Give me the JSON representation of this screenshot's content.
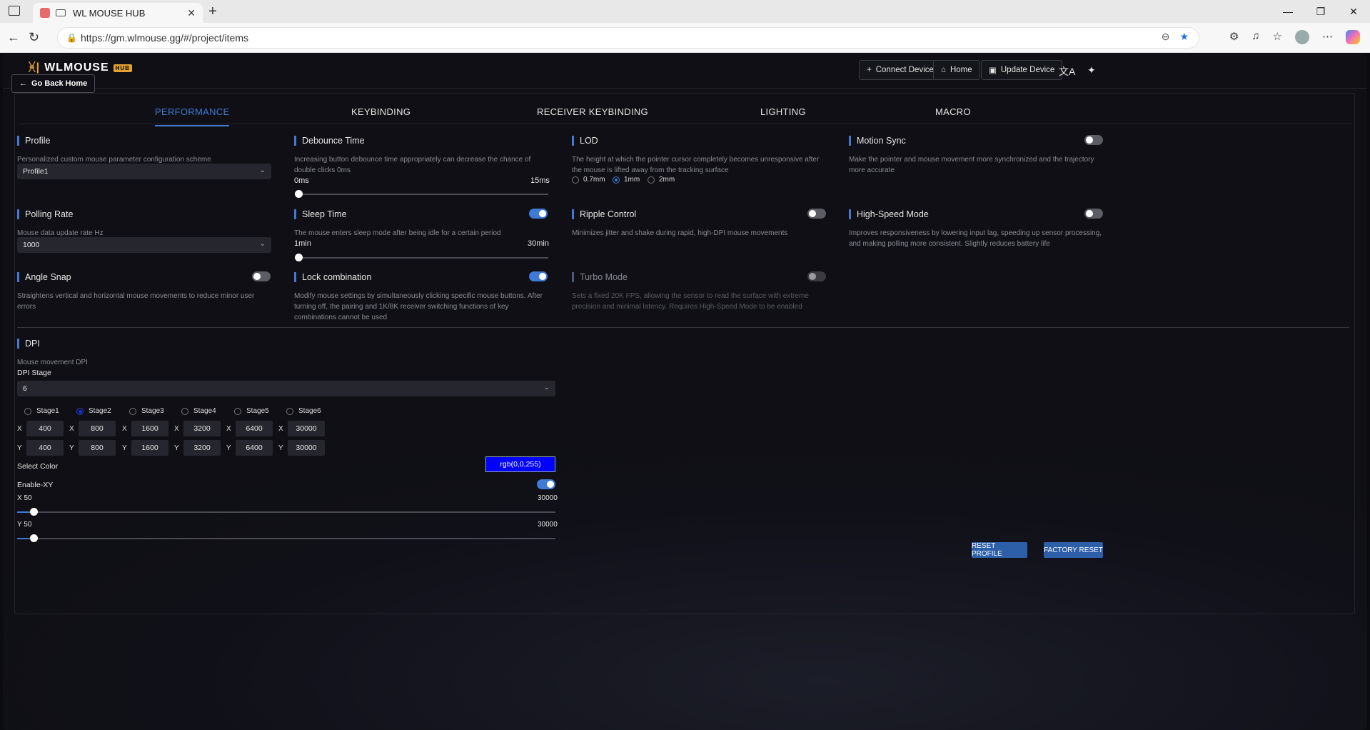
{
  "browser": {
    "tab_title": "WL MOUSE HUB",
    "url": "https://gm.wlmouse.gg/#/project/items"
  },
  "header": {
    "logo": "WLMOUSE",
    "connect_label": "Connect Device",
    "home_label": "Home",
    "update_label": "Update Device"
  },
  "go_back_label": "Go Back Home",
  "tabs": [
    "PERFORMANCE",
    "KEYBINDING",
    "RECEIVER KEYBINDING",
    "LIGHTING",
    "MACRO"
  ],
  "profile": {
    "title": "Profile",
    "desc": "Personalized custom mouse parameter configuration scheme",
    "value": "Profile1"
  },
  "debounce": {
    "title": "Debounce Time",
    "desc": "Increasing button debounce time appropriately can decrease the chance of double clicks 0ms",
    "min": "0ms",
    "max": "15ms",
    "level": 0
  },
  "lod": {
    "title": "LOD",
    "desc": "The height at which the pointer cursor completely becomes unresponsive after the mouse is lifted away from the tracking surface",
    "options": [
      "0.7mm",
      "1mm",
      "2mm"
    ],
    "selected": "1mm"
  },
  "motion_sync": {
    "title": "Motion Sync",
    "desc": "Make the pointer and mouse movement more synchronized and the trajectory more accurate",
    "on": false
  },
  "polling": {
    "title": "Polling Rate",
    "desc": "Mouse data update rate Hz",
    "value": "1000"
  },
  "sleep": {
    "title": "Sleep Time",
    "desc": "The mouse enters sleep mode after being idle for a certain period",
    "min": "1min",
    "max": "30min",
    "on": true,
    "level": 0
  },
  "ripple": {
    "title": "Ripple Control",
    "desc": "Minimizes jitter and shake during rapid, high-DPI mouse movements",
    "on": false
  },
  "highspeed": {
    "title": "High-Speed Mode",
    "desc": "Improves responsiveness by lowering input lag, speeding up sensor processing, and making polling more consistent. Slightly reduces battery life",
    "on": false
  },
  "angle": {
    "title": "Angle Snap",
    "desc": "Straightens vertical and horizontal mouse movements to reduce minor user errors",
    "on": false
  },
  "lock": {
    "title": "Lock combination",
    "desc": "Modify mouse settings by simultaneously clicking specific mouse buttons.  After turning off, the pairing and 1K/8K receiver switching functions of key combinations cannot be used",
    "on": true
  },
  "turbo": {
    "title": "Turbo Mode",
    "desc": "Sets a fixed 20K FPS, allowing the sensor to read the surface with extreme precision and minimal latency. Requires High-Speed Mode to be enabled",
    "on": false
  },
  "dpi": {
    "title": "DPI",
    "desc": "Mouse movement DPI",
    "stage_label": "DPI Stage",
    "stage_value": "6",
    "stages": [
      "Stage1",
      "Stage2",
      "Stage3",
      "Stage4",
      "Stage5",
      "Stage6"
    ],
    "selected_stage": "Stage2",
    "x_label": "X",
    "y_label": "Y",
    "x_values": [
      "400",
      "800",
      "1600",
      "3200",
      "6400",
      "30000"
    ],
    "y_values": [
      "400",
      "800",
      "1600",
      "3200",
      "6400",
      "30000"
    ],
    "color_label": "Select Color",
    "color_value": "rgb(0,0,255)",
    "enable_xy_label": "Enable-XY",
    "enable_xy": true,
    "x_slider_label": "X 50",
    "x_slider_max": "30000",
    "y_slider_label": "Y 50",
    "y_slider_max": "30000"
  },
  "buttons": {
    "reset_profile": "RESET PROFILE",
    "factory_reset": "FACTORY RESET"
  },
  "colors": {
    "accent": "#3f7bd4",
    "background": "#0f0f15",
    "swatch": "#0000ff"
  }
}
